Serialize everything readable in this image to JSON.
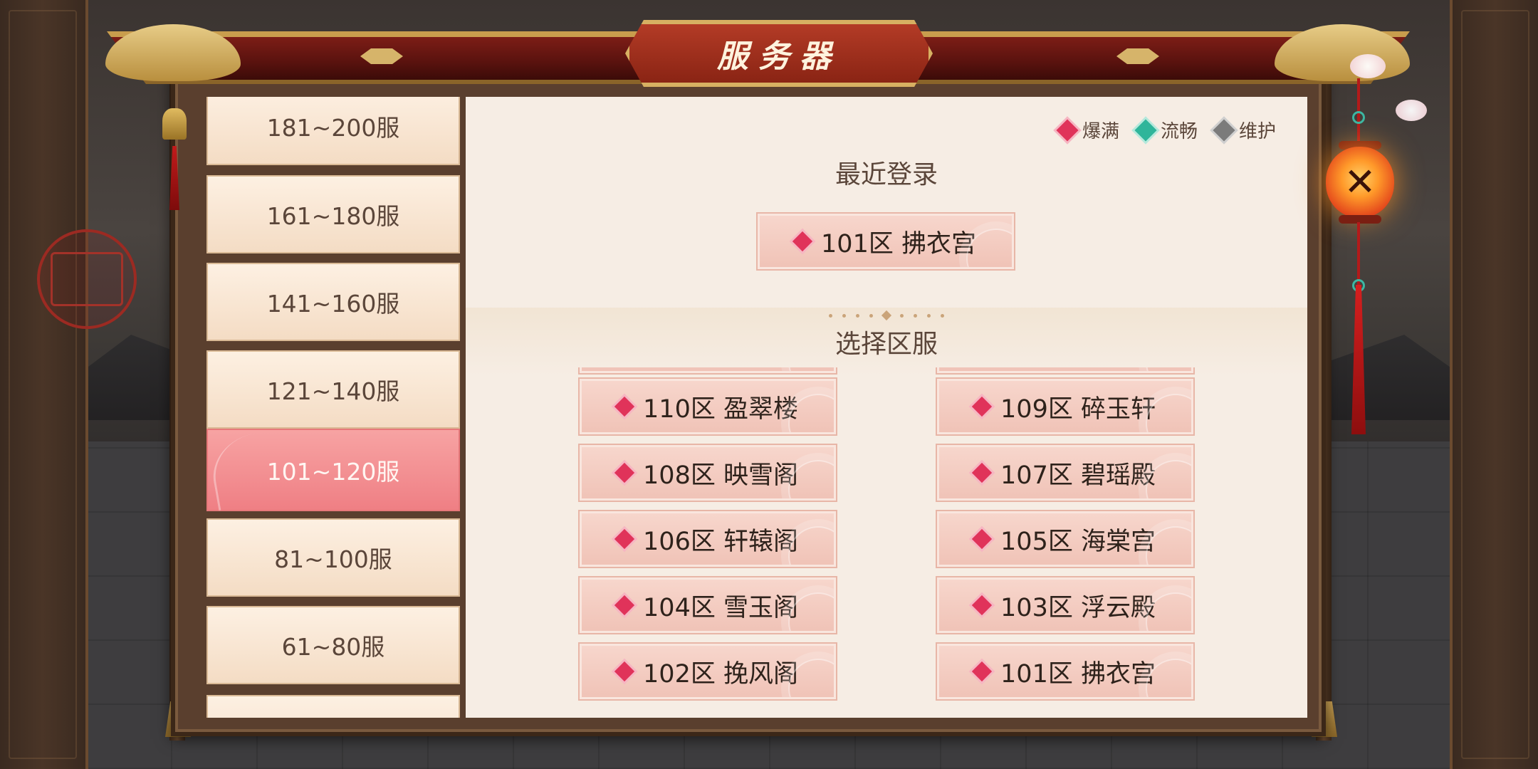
{
  "title": "服务器",
  "legend": [
    {
      "label": "爆满",
      "color": "#e0335a",
      "icon": "red-diamond"
    },
    {
      "label": "流畅",
      "color": "#2fb59a",
      "icon": "green-diamond"
    },
    {
      "label": "维护",
      "color": "#7b7b7b",
      "icon": "gray-diamond"
    }
  ],
  "recent": {
    "heading": "最近登录",
    "server": "101区 拂衣宫"
  },
  "select": {
    "heading": "选择区服",
    "servers": [
      "110区 盈翠楼",
      "109区 碎玉轩",
      "108区 映雪阁",
      "107区 碧瑶殿",
      "106区 轩辕阁",
      "105区 海棠宫",
      "104区 雪玉阁",
      "103区 浮云殿",
      "102区 挽风阁",
      "101区 拂衣宫"
    ]
  },
  "ranges": [
    {
      "label": "181~200服",
      "active": false
    },
    {
      "label": "161~180服",
      "active": false
    },
    {
      "label": "141~160服",
      "active": false
    },
    {
      "label": "121~140服",
      "active": false
    },
    {
      "label": "101~120服",
      "active": true
    },
    {
      "label": "81~100服",
      "active": false
    },
    {
      "label": "61~80服",
      "active": false
    },
    {
      "label": "",
      "active": false
    }
  ],
  "close_icon": "close-x",
  "colors": {
    "accent": "#e0335a",
    "active_range": "#ef7f84",
    "panel_bg": "#f6ede4"
  }
}
